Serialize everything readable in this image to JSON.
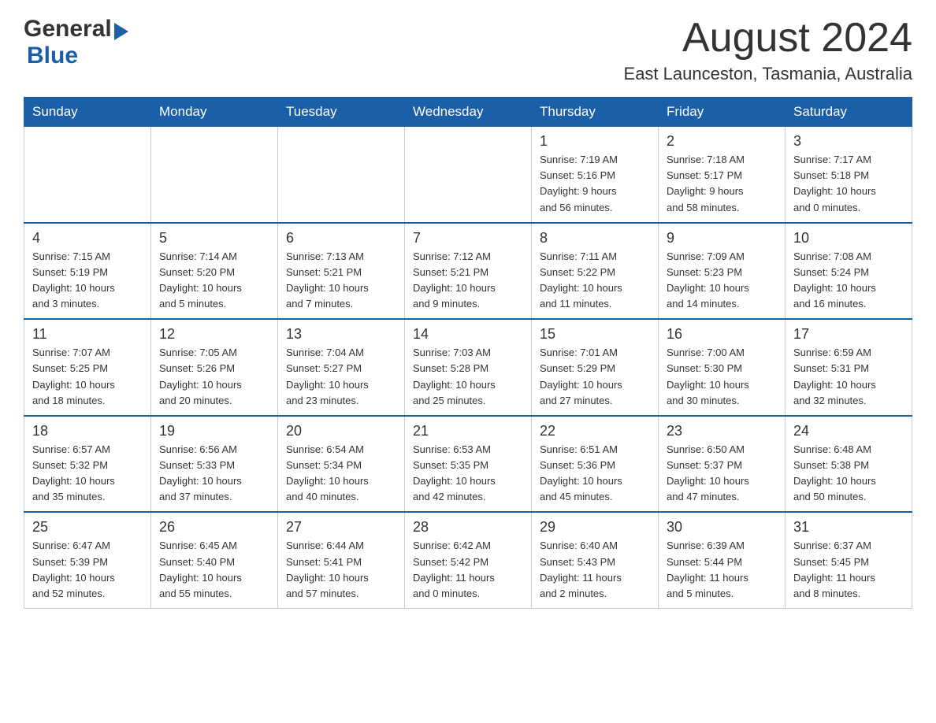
{
  "header": {
    "logo_general": "General",
    "logo_blue": "Blue",
    "month_title": "August 2024",
    "location": "East Launceston, Tasmania, Australia"
  },
  "weekdays": [
    "Sunday",
    "Monday",
    "Tuesday",
    "Wednesday",
    "Thursday",
    "Friday",
    "Saturday"
  ],
  "weeks": [
    [
      {
        "day": "",
        "info": ""
      },
      {
        "day": "",
        "info": ""
      },
      {
        "day": "",
        "info": ""
      },
      {
        "day": "",
        "info": ""
      },
      {
        "day": "1",
        "info": "Sunrise: 7:19 AM\nSunset: 5:16 PM\nDaylight: 9 hours\nand 56 minutes."
      },
      {
        "day": "2",
        "info": "Sunrise: 7:18 AM\nSunset: 5:17 PM\nDaylight: 9 hours\nand 58 minutes."
      },
      {
        "day": "3",
        "info": "Sunrise: 7:17 AM\nSunset: 5:18 PM\nDaylight: 10 hours\nand 0 minutes."
      }
    ],
    [
      {
        "day": "4",
        "info": "Sunrise: 7:15 AM\nSunset: 5:19 PM\nDaylight: 10 hours\nand 3 minutes."
      },
      {
        "day": "5",
        "info": "Sunrise: 7:14 AM\nSunset: 5:20 PM\nDaylight: 10 hours\nand 5 minutes."
      },
      {
        "day": "6",
        "info": "Sunrise: 7:13 AM\nSunset: 5:21 PM\nDaylight: 10 hours\nand 7 minutes."
      },
      {
        "day": "7",
        "info": "Sunrise: 7:12 AM\nSunset: 5:21 PM\nDaylight: 10 hours\nand 9 minutes."
      },
      {
        "day": "8",
        "info": "Sunrise: 7:11 AM\nSunset: 5:22 PM\nDaylight: 10 hours\nand 11 minutes."
      },
      {
        "day": "9",
        "info": "Sunrise: 7:09 AM\nSunset: 5:23 PM\nDaylight: 10 hours\nand 14 minutes."
      },
      {
        "day": "10",
        "info": "Sunrise: 7:08 AM\nSunset: 5:24 PM\nDaylight: 10 hours\nand 16 minutes."
      }
    ],
    [
      {
        "day": "11",
        "info": "Sunrise: 7:07 AM\nSunset: 5:25 PM\nDaylight: 10 hours\nand 18 minutes."
      },
      {
        "day": "12",
        "info": "Sunrise: 7:05 AM\nSunset: 5:26 PM\nDaylight: 10 hours\nand 20 minutes."
      },
      {
        "day": "13",
        "info": "Sunrise: 7:04 AM\nSunset: 5:27 PM\nDaylight: 10 hours\nand 23 minutes."
      },
      {
        "day": "14",
        "info": "Sunrise: 7:03 AM\nSunset: 5:28 PM\nDaylight: 10 hours\nand 25 minutes."
      },
      {
        "day": "15",
        "info": "Sunrise: 7:01 AM\nSunset: 5:29 PM\nDaylight: 10 hours\nand 27 minutes."
      },
      {
        "day": "16",
        "info": "Sunrise: 7:00 AM\nSunset: 5:30 PM\nDaylight: 10 hours\nand 30 minutes."
      },
      {
        "day": "17",
        "info": "Sunrise: 6:59 AM\nSunset: 5:31 PM\nDaylight: 10 hours\nand 32 minutes."
      }
    ],
    [
      {
        "day": "18",
        "info": "Sunrise: 6:57 AM\nSunset: 5:32 PM\nDaylight: 10 hours\nand 35 minutes."
      },
      {
        "day": "19",
        "info": "Sunrise: 6:56 AM\nSunset: 5:33 PM\nDaylight: 10 hours\nand 37 minutes."
      },
      {
        "day": "20",
        "info": "Sunrise: 6:54 AM\nSunset: 5:34 PM\nDaylight: 10 hours\nand 40 minutes."
      },
      {
        "day": "21",
        "info": "Sunrise: 6:53 AM\nSunset: 5:35 PM\nDaylight: 10 hours\nand 42 minutes."
      },
      {
        "day": "22",
        "info": "Sunrise: 6:51 AM\nSunset: 5:36 PM\nDaylight: 10 hours\nand 45 minutes."
      },
      {
        "day": "23",
        "info": "Sunrise: 6:50 AM\nSunset: 5:37 PM\nDaylight: 10 hours\nand 47 minutes."
      },
      {
        "day": "24",
        "info": "Sunrise: 6:48 AM\nSunset: 5:38 PM\nDaylight: 10 hours\nand 50 minutes."
      }
    ],
    [
      {
        "day": "25",
        "info": "Sunrise: 6:47 AM\nSunset: 5:39 PM\nDaylight: 10 hours\nand 52 minutes."
      },
      {
        "day": "26",
        "info": "Sunrise: 6:45 AM\nSunset: 5:40 PM\nDaylight: 10 hours\nand 55 minutes."
      },
      {
        "day": "27",
        "info": "Sunrise: 6:44 AM\nSunset: 5:41 PM\nDaylight: 10 hours\nand 57 minutes."
      },
      {
        "day": "28",
        "info": "Sunrise: 6:42 AM\nSunset: 5:42 PM\nDaylight: 11 hours\nand 0 minutes."
      },
      {
        "day": "29",
        "info": "Sunrise: 6:40 AM\nSunset: 5:43 PM\nDaylight: 11 hours\nand 2 minutes."
      },
      {
        "day": "30",
        "info": "Sunrise: 6:39 AM\nSunset: 5:44 PM\nDaylight: 11 hours\nand 5 minutes."
      },
      {
        "day": "31",
        "info": "Sunrise: 6:37 AM\nSunset: 5:45 PM\nDaylight: 11 hours\nand 8 minutes."
      }
    ]
  ]
}
